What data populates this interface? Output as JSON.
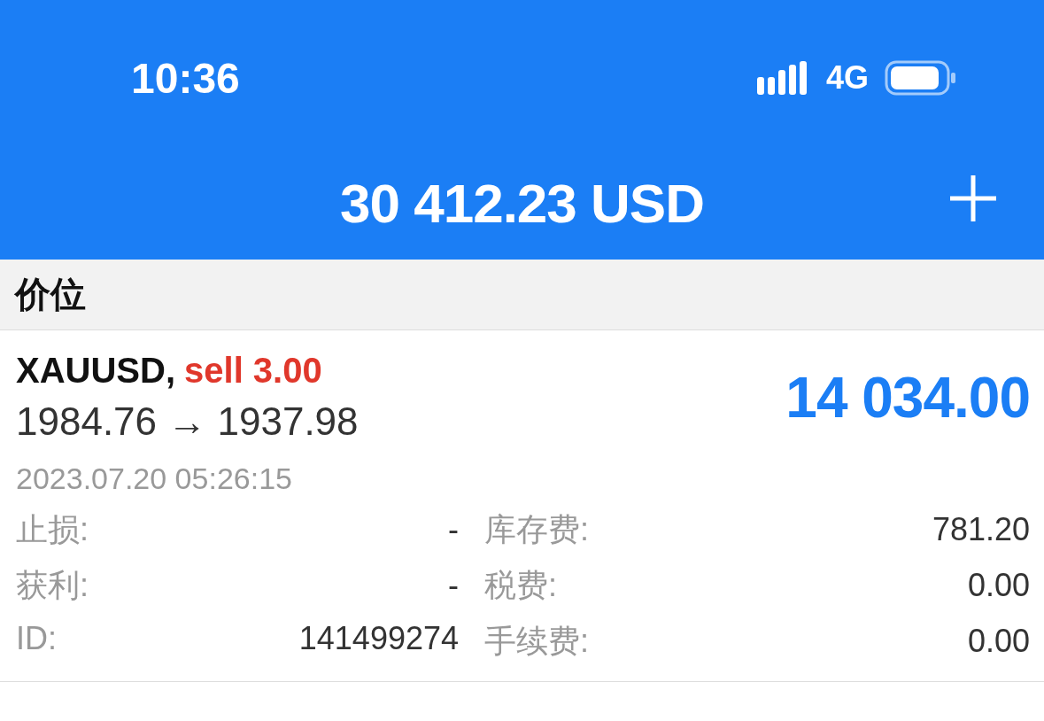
{
  "status_bar": {
    "time": "10:36",
    "network": "4G"
  },
  "header": {
    "balance": "30 412.23 USD"
  },
  "section": {
    "title": "价位"
  },
  "positions": [
    {
      "symbol": "XAUUSD,",
      "side": "sell 3.00",
      "prices": "1984.76 → 1937.98",
      "profit": "14 034.00",
      "time": "2023.07.20 05:26:15",
      "detail_rows": [
        {
          "left_label": "止损:",
          "left_value": "-",
          "right_label": "库存费:",
          "right_value": "781.20"
        },
        {
          "left_label": "获利:",
          "left_value": "-",
          "right_label": "税费:",
          "right_value": "0.00"
        },
        {
          "left_label": "ID:",
          "left_value": "141499274",
          "right_label": "手续费:",
          "right_value": "0.00"
        }
      ]
    }
  ]
}
